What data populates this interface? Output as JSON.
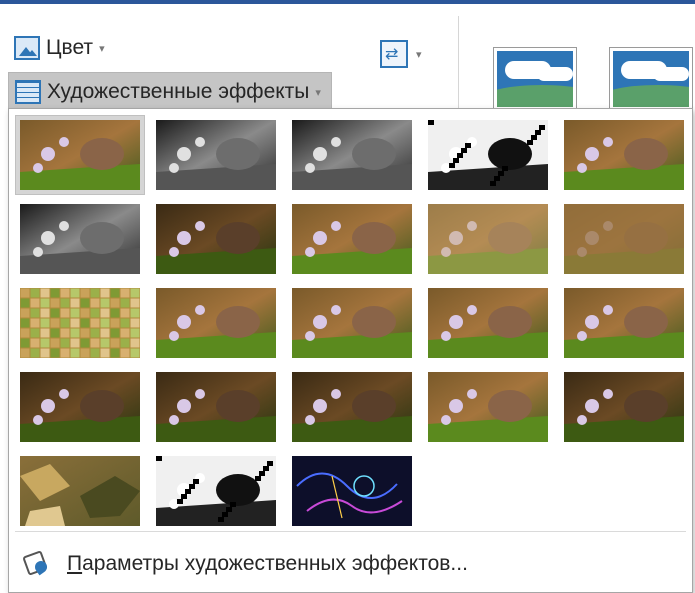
{
  "ribbon": {
    "color_button": {
      "label": "Цвет",
      "icon": "picture-color-icon"
    },
    "effects_button": {
      "label": "Художественные эффекты",
      "icon": "artistic-effects-icon"
    },
    "change_picture_icon": "change-picture-icon",
    "dropdown_arrow": "▾",
    "style_thumbs": [
      "picture-style-1",
      "picture-style-2"
    ]
  },
  "gallery": {
    "effects": [
      "Нет",
      "Маркер",
      "Рисунок карандашом",
      "Набросок",
      "Рисунок линиями",
      "Мел",
      "Рисунок маслом",
      "Акварельная губка",
      "Размытие",
      "Размытие сильное",
      "Мозаика",
      "Пленка с зерном",
      "Светящиеся края",
      "Сжатие пленки",
      "Штриховка",
      "Пастель",
      "Перекрестная штриховка",
      "Текстуризация",
      "Фотокопия",
      "Пластиковая упаковка",
      "Бумажные обрывки",
      "Цементная штукатурка",
      "Светящийся контур"
    ],
    "selected_index": 0
  },
  "footer": {
    "options_underlined": "П",
    "options_rest": "араметры художественных эффектов...",
    "icon": "artistic-effects-options-icon"
  },
  "colors": {
    "accent": "#2e75b6",
    "selected_tile_bg": "#d5d5d5",
    "ribbon_top": "#2b579a"
  }
}
